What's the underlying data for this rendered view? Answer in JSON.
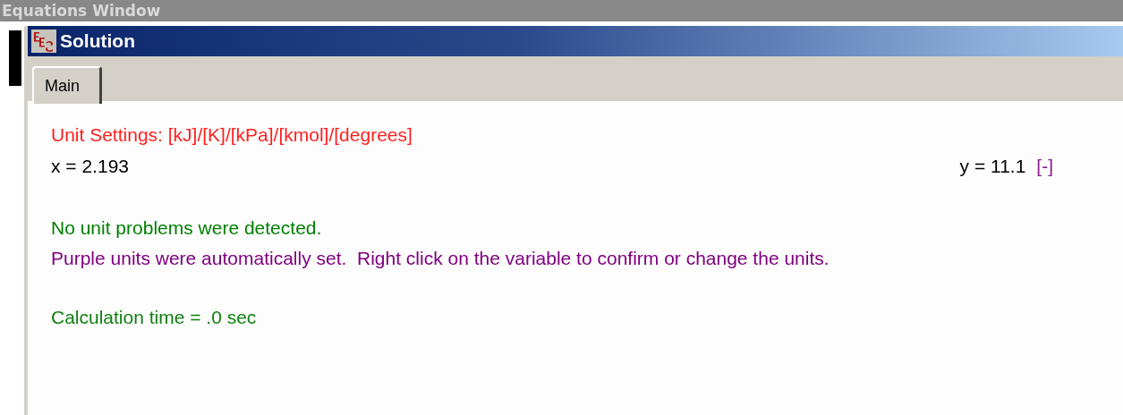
{
  "background_window": {
    "title": "Equations Window"
  },
  "window": {
    "title": "Solution"
  },
  "tabs": [
    {
      "label": "Main",
      "selected": true
    }
  ],
  "unit_settings": "Unit Settings: [kJ]/[K]/[kPa]/[kmol]/[degrees]",
  "variables": [
    {
      "text": "x = 2.193"
    },
    {
      "text": "y = 11.1",
      "unit": "[-]"
    }
  ],
  "messages": [
    {
      "text": "No unit problems were detected.",
      "color": "#008000"
    },
    {
      "text": "Purple units were automatically set.  Right click on the variable to confirm or change the units.",
      "color": "#800080"
    }
  ],
  "calculation_time": "Calculation time = .0 sec"
}
